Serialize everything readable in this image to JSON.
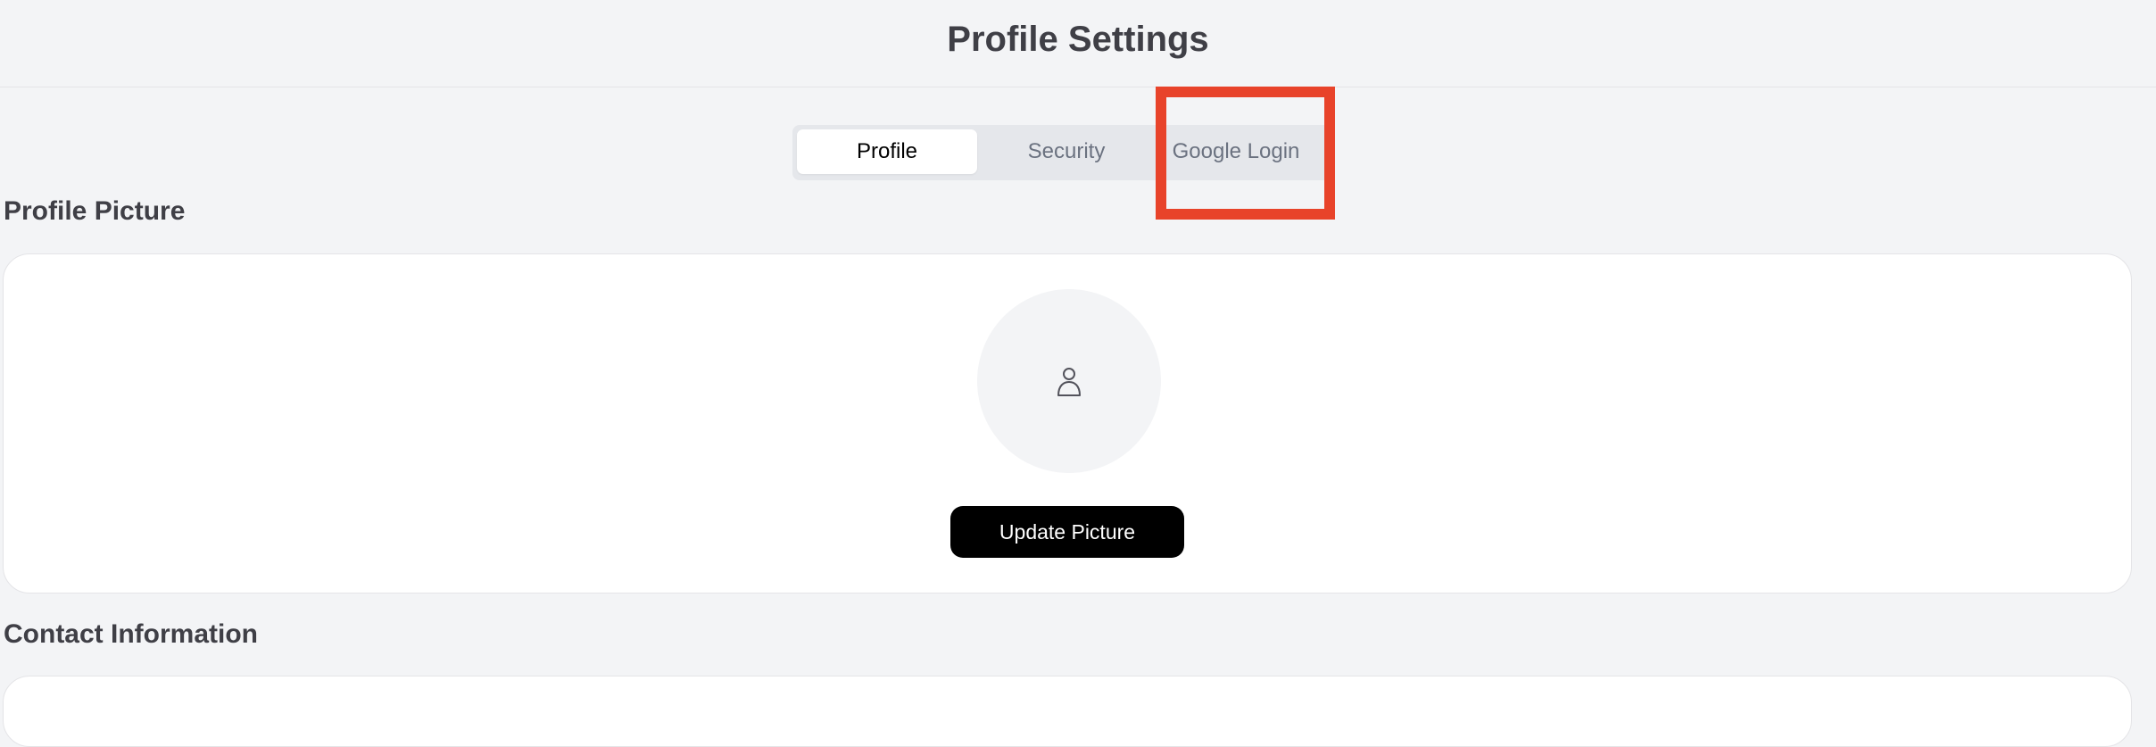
{
  "header": {
    "title": "Profile Settings"
  },
  "tabs": [
    {
      "label": "Profile",
      "active": true
    },
    {
      "label": "Security",
      "active": false
    },
    {
      "label": "Google Login",
      "active": false
    }
  ],
  "profile_picture": {
    "section_title": "Profile Picture",
    "avatar_icon": "user-icon",
    "update_button_label": "Update Picture"
  },
  "contact_information": {
    "section_title": "Contact Information"
  },
  "colors": {
    "background": "#f3f4f6",
    "highlight": "#e8432a",
    "button": "#000000"
  }
}
